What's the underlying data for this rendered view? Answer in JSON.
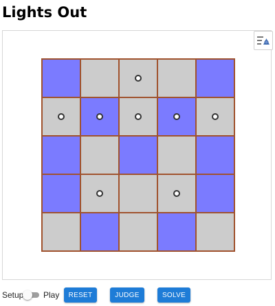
{
  "title": "Lights Out",
  "board": {
    "size": 5,
    "cells": [
      [
        1,
        0,
        0,
        0,
        1
      ],
      [
        0,
        1,
        0,
        1,
        0
      ],
      [
        1,
        0,
        1,
        0,
        1
      ],
      [
        1,
        0,
        0,
        0,
        1
      ],
      [
        0,
        1,
        0,
        1,
        0
      ]
    ],
    "markers": [
      [
        0,
        0,
        1,
        0,
        0
      ],
      [
        1,
        1,
        1,
        1,
        1
      ],
      [
        0,
        0,
        0,
        0,
        0
      ],
      [
        0,
        1,
        0,
        1,
        0
      ],
      [
        0,
        0,
        0,
        0,
        0
      ]
    ],
    "on_color": "#7b7bff",
    "off_color": "#cccccc",
    "border_color": "#a0522d"
  },
  "menu_icon": "list-settings-icon",
  "controls": {
    "setup_label": "Setup",
    "play_label": "Play",
    "mode": "setup",
    "reset_label": "RESET",
    "judge_label": "JUDGE",
    "solve_label": "SOLVE",
    "button_color": "#1e7cd7"
  }
}
